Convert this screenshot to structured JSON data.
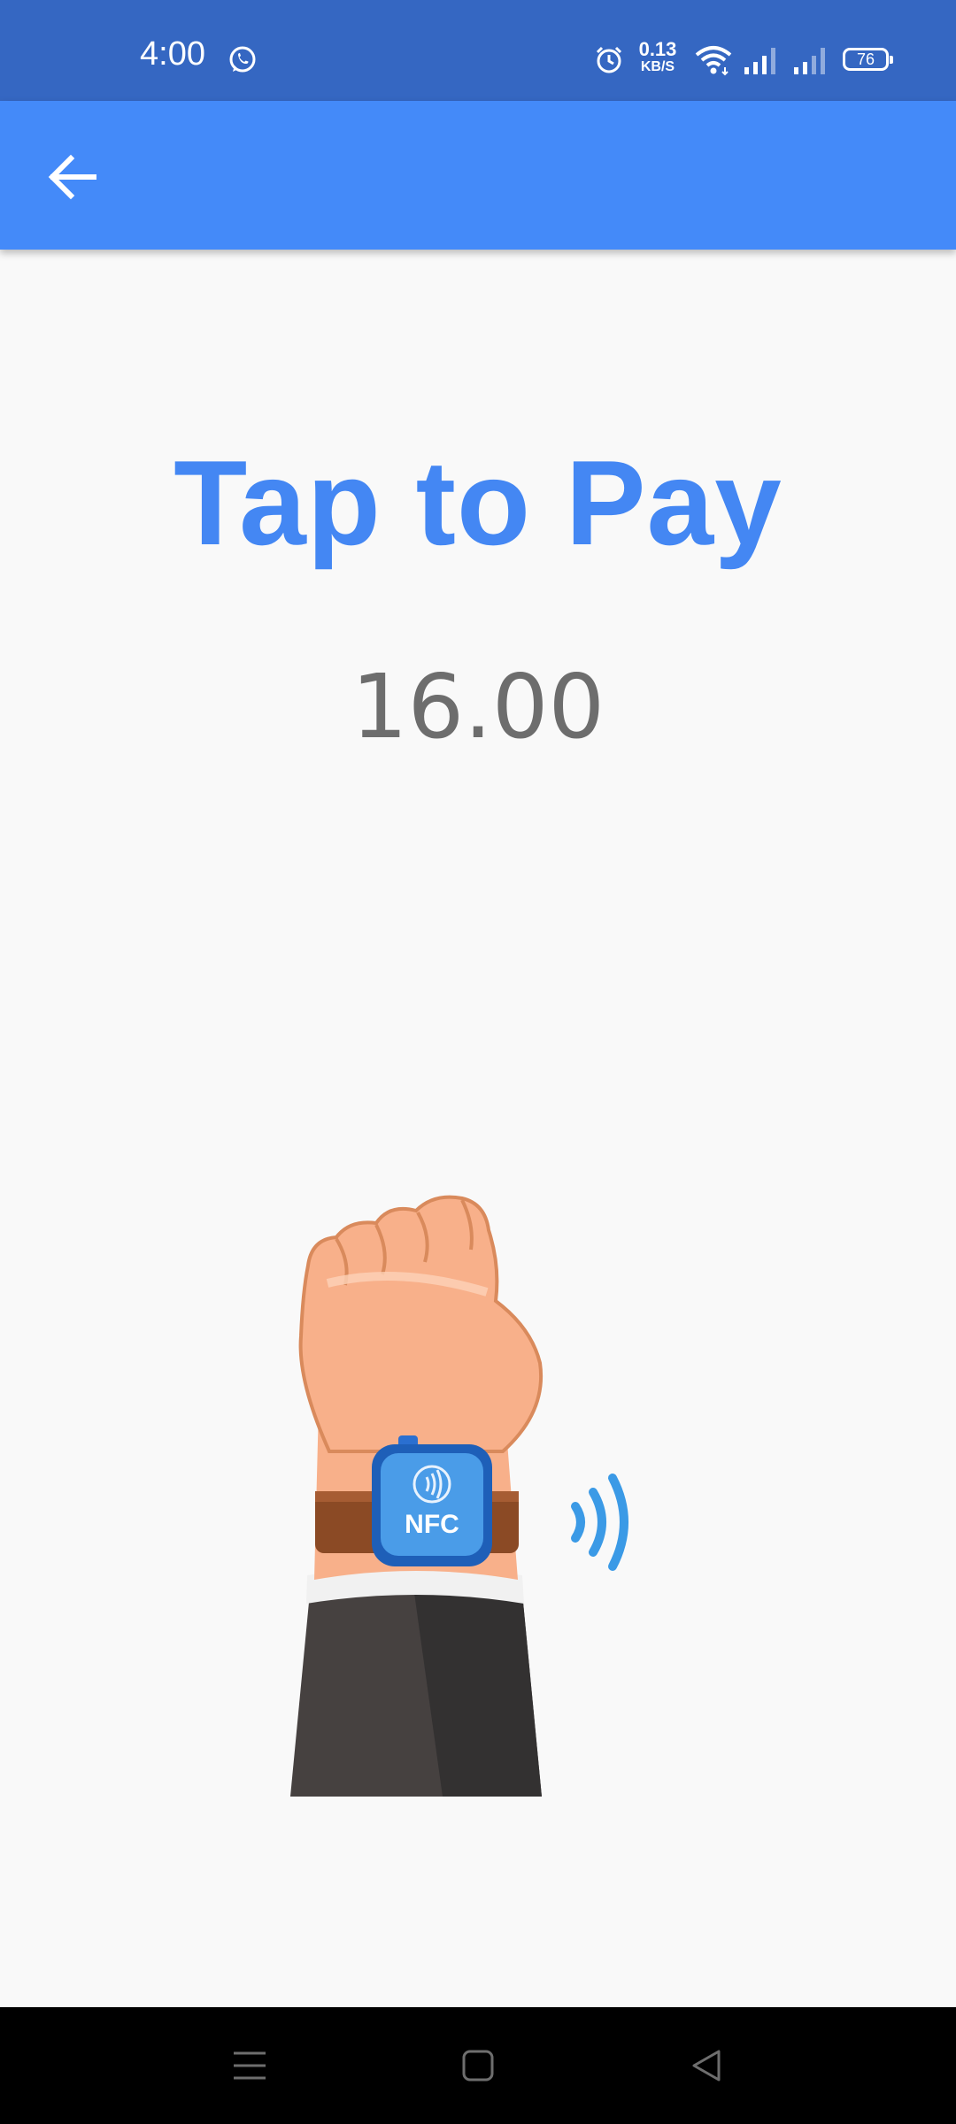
{
  "status_bar": {
    "time": "4:00",
    "speed_value": "0.13",
    "speed_unit": "KB/S",
    "battery": "76",
    "icons": [
      "whatsapp-icon",
      "alarm-icon",
      "wifi-icon",
      "signal-icon",
      "signal-icon",
      "battery-icon"
    ]
  },
  "app_bar": {
    "back_icon": "arrow-left-icon",
    "color": "#448af9"
  },
  "main": {
    "title": "Tap to Pay",
    "amount": "16.00",
    "illustration": {
      "badge_text": "NFC"
    }
  },
  "nav_bar": {
    "buttons": [
      "menu-icon",
      "home-icon",
      "back-triangle-icon"
    ]
  },
  "colors": {
    "status_bar": "#3567c2",
    "accent": "#4487f3",
    "amount_text": "#6d6d6d",
    "background": "#f9f9f9"
  }
}
